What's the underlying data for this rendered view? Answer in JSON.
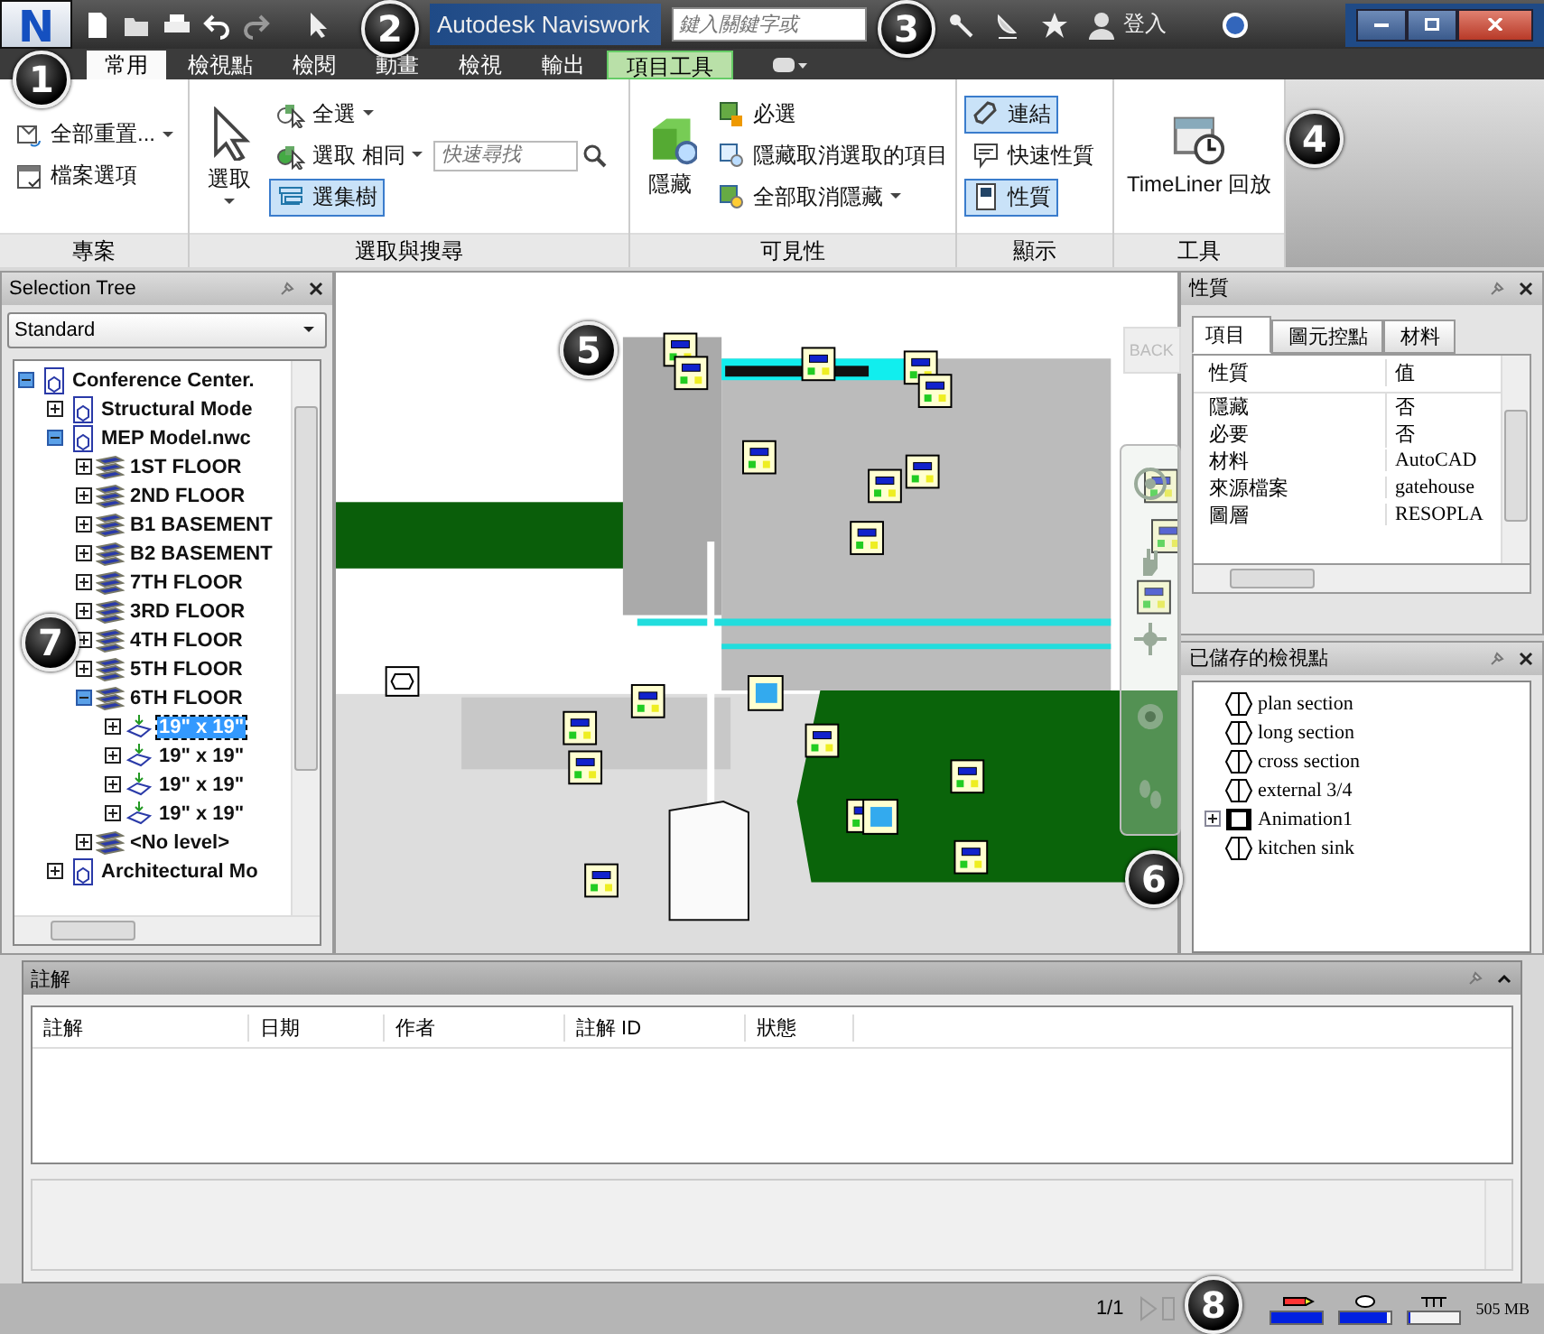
{
  "app_button": {
    "letter": "N"
  },
  "title_bar": {
    "title": "Autodesk Naviswork",
    "search": {
      "placeholder": "鍵入關鍵字或"
    },
    "sign_in": "登入"
  },
  "ribbon_tabs": [
    {
      "label": "常用",
      "selected": true,
      "kind": "normal"
    },
    {
      "label": "檢視點",
      "selected": false,
      "kind": "normal"
    },
    {
      "label": "檢閱",
      "selected": false,
      "kind": "normal"
    },
    {
      "label": "動畫",
      "selected": false,
      "kind": "normal"
    },
    {
      "label": "檢視",
      "selected": false,
      "kind": "normal"
    },
    {
      "label": "輸出",
      "selected": false,
      "kind": "normal"
    },
    {
      "label": "項目工具",
      "selected": false,
      "kind": "contextual"
    }
  ],
  "ribbon_panels": [
    {
      "title": "專案",
      "controls": [
        {
          "label": "全部重置...",
          "dropdown": true,
          "active": false
        },
        {
          "label": "檔案選項",
          "dropdown": false,
          "active": false
        }
      ]
    },
    {
      "title": "選取與搜尋",
      "controls": [
        {
          "label": "選取",
          "dropdown": true,
          "active": false
        },
        {
          "label": "全選",
          "dropdown": true,
          "active": false
        },
        {
          "label": "選取 相同",
          "dropdown": true,
          "active": false
        },
        {
          "label": "選集樹",
          "dropdown": false,
          "active": true
        }
      ],
      "search": {
        "placeholder": "快速尋找"
      }
    },
    {
      "title": "可見性",
      "controls": [
        {
          "label": "隱藏",
          "dropdown": false,
          "active": false
        },
        {
          "label": "必選",
          "dropdown": false,
          "active": false
        },
        {
          "label": "隱藏取消選取的項目",
          "dropdown": false,
          "active": false
        },
        {
          "label": "全部取消隱藏",
          "dropdown": true,
          "active": false
        }
      ]
    },
    {
      "title": "顯示",
      "controls": [
        {
          "label": "連結",
          "dropdown": false,
          "active": true
        },
        {
          "label": "快速性質",
          "dropdown": false,
          "active": false
        },
        {
          "label": "性質",
          "dropdown": false,
          "active": true
        }
      ]
    },
    {
      "title": "工具",
      "controls": [
        {
          "label": "TimeLiner 回放",
          "dropdown": false,
          "active": false
        }
      ]
    }
  ],
  "selection_tree": {
    "title": "Selection Tree",
    "mode": "Standard",
    "items": [
      {
        "label": "Conference Center.",
        "kind": "model",
        "expanded": true,
        "selected": false,
        "children": [
          {
            "label": "Structural Mode",
            "kind": "model",
            "expanded": false,
            "selected": false
          },
          {
            "label": "MEP Model.nwc",
            "kind": "model",
            "expanded": true,
            "selected": false,
            "children": [
              {
                "label": "1ST FLOOR",
                "kind": "level",
                "expanded": false,
                "selected": false
              },
              {
                "label": "2ND FLOOR",
                "kind": "level",
                "expanded": false,
                "selected": false
              },
              {
                "label": "B1 BASEMENT",
                "kind": "level",
                "expanded": false,
                "selected": false
              },
              {
                "label": "B2  BASEMENT",
                "kind": "level",
                "expanded": false,
                "selected": false
              },
              {
                "label": "7TH FLOOR",
                "kind": "level",
                "expanded": false,
                "selected": false
              },
              {
                "label": "3RD FLOOR",
                "kind": "level",
                "expanded": false,
                "selected": false
              },
              {
                "label": "4TH FLOOR",
                "kind": "level",
                "expanded": false,
                "selected": false
              },
              {
                "label": "5TH FLOOR",
                "kind": "level",
                "expanded": false,
                "selected": false
              },
              {
                "label": "6TH FLOOR",
                "kind": "level",
                "expanded": true,
                "selected": false,
                "children": [
                  {
                    "label": "19\" x 19\"",
                    "kind": "item",
                    "expanded": false,
                    "selected": true
                  },
                  {
                    "label": "19\" x 19\"",
                    "kind": "item",
                    "expanded": false,
                    "selected": false
                  },
                  {
                    "label": "19\" x 19\"",
                    "kind": "item",
                    "expanded": false,
                    "selected": false
                  },
                  {
                    "label": "19\" x 19\"",
                    "kind": "item",
                    "expanded": false,
                    "selected": false
                  }
                ]
              },
              {
                "label": "<No level>",
                "kind": "level",
                "expanded": false,
                "selected": false
              }
            ]
          },
          {
            "label": "Architectural Mo",
            "kind": "model",
            "expanded": false,
            "selected": false
          }
        ]
      }
    ]
  },
  "viewport": {
    "viewcube_label": "BACK"
  },
  "properties": {
    "title": "性質",
    "tabs": [
      {
        "label": "項目",
        "selected": true
      },
      {
        "label": "圖元控點",
        "selected": false
      },
      {
        "label": "材料",
        "selected": false
      }
    ],
    "columns": [
      "性質",
      "值"
    ],
    "rows": [
      [
        "隱藏",
        "否"
      ],
      [
        "必要",
        "否"
      ],
      [
        "材料",
        "AutoCAD"
      ],
      [
        "來源檔案",
        "gatehouse"
      ],
      [
        "圖層",
        "RESOPLA"
      ]
    ]
  },
  "saved_viewpoints": {
    "title": "已儲存的檢視點",
    "items": [
      {
        "label": "plan section",
        "kind": "viewpoint"
      },
      {
        "label": "long section",
        "kind": "viewpoint"
      },
      {
        "label": "cross section",
        "kind": "viewpoint"
      },
      {
        "label": "external 3/4",
        "kind": "viewpoint"
      },
      {
        "label": "Animation1",
        "kind": "animation"
      },
      {
        "label": "kitchen sink",
        "kind": "viewpoint"
      }
    ]
  },
  "comments": {
    "title": "註解",
    "columns": [
      "註解",
      "日期",
      "作者",
      "註解 ID",
      "狀態"
    ]
  },
  "status_bar": {
    "page": "1/1",
    "meters": [
      {
        "level": 1
      },
      {
        "level": 0.9
      },
      {
        "level": 0
      }
    ],
    "memory": "505 MB"
  },
  "callouts": [
    "1",
    "2",
    "3",
    "4",
    "5",
    "6",
    "7",
    "8"
  ]
}
